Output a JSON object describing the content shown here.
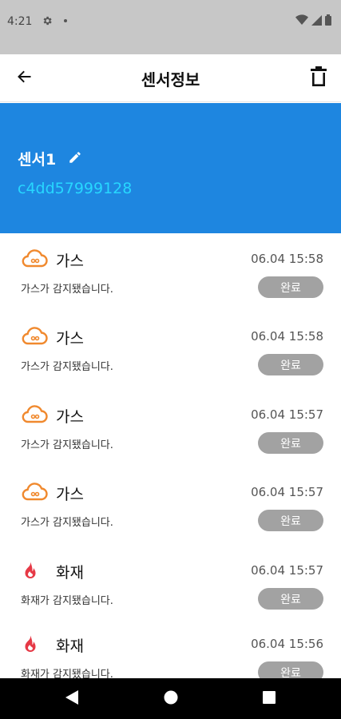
{
  "status_bar": {
    "time": "4:21"
  },
  "app_bar": {
    "title": "센서정보"
  },
  "sensor": {
    "name": "센서1",
    "id": "c4dd57999128"
  },
  "colors": {
    "header_bg": "#1e86e0",
    "gas_icon": "#f0892e",
    "fire_icon": "#e63946",
    "pill_bg": "#a2a2a2"
  },
  "events": [
    {
      "icon": "gas-cloud-icon",
      "type": "가스",
      "time": "06.04 15:58",
      "message": "가스가 감지됐습니다.",
      "status": "완료"
    },
    {
      "icon": "gas-cloud-icon",
      "type": "가스",
      "time": "06.04 15:58",
      "message": "가스가 감지됐습니다.",
      "status": "완료"
    },
    {
      "icon": "gas-cloud-icon",
      "type": "가스",
      "time": "06.04 15:57",
      "message": "가스가 감지됐습니다.",
      "status": "완료"
    },
    {
      "icon": "gas-cloud-icon",
      "type": "가스",
      "time": "06.04 15:57",
      "message": "가스가 감지됐습니다.",
      "status": "완료"
    },
    {
      "icon": "fire-icon",
      "type": "화재",
      "time": "06.04 15:57",
      "message": "화재가 감지됐습니다.",
      "status": "완료"
    },
    {
      "icon": "fire-icon",
      "type": "화재",
      "time": "06.04 15:56",
      "message": "화재가 감지됐습니다.",
      "status": "완료"
    }
  ]
}
